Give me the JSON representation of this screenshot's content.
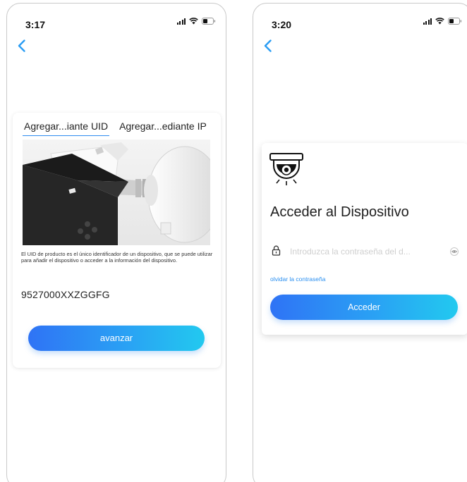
{
  "left_screen": {
    "status_bar": {
      "time": "3:17"
    },
    "tabs": [
      {
        "label": "Agregar...iante UID",
        "active": true
      },
      {
        "label": "Agregar...ediante IP",
        "active": false
      }
    ],
    "description": "El UID de producto es el único identificador de un dispositivo, que se puede utilizar para añadir el dispositivo o acceder a la información del dispositivo.",
    "uid_value": "9527000XXZGGFG",
    "advance_button": "avanzar"
  },
  "right_screen": {
    "status_bar": {
      "time": "3:20"
    },
    "title": "Acceder al Dispositivo",
    "password_placeholder": "Introduzca la contraseña del d...",
    "forgot_password": "olvidar la contraseña",
    "login_button": "Acceder"
  },
  "icons": {
    "back": "chevron-left-icon",
    "signal": "signal-icon",
    "wifi": "wifi-icon",
    "battery": "battery-icon",
    "camera": "dome-camera-icon",
    "lock": "lock-icon",
    "eye": "eye-icon"
  },
  "colors": {
    "accent": "#2f8cf0",
    "button_gradient_start": "#2f73f5",
    "button_gradient_end": "#22c9ef"
  }
}
